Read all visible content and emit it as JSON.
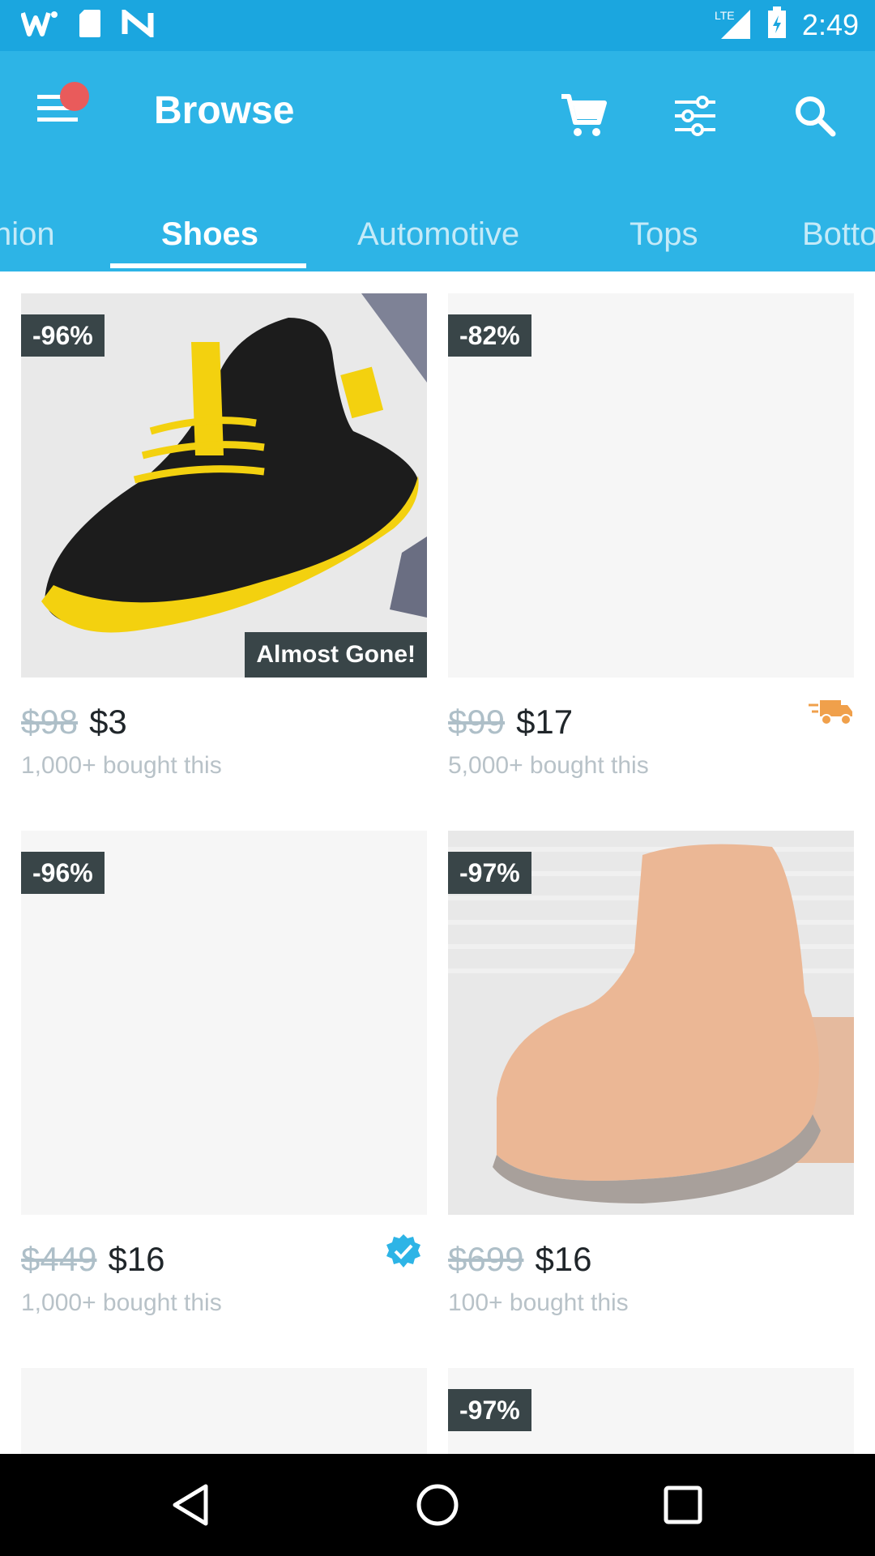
{
  "status": {
    "time": "2:49",
    "network": "LTE"
  },
  "header": {
    "title": "Browse"
  },
  "tabs": [
    {
      "label": "hion"
    },
    {
      "label": "Shoes"
    },
    {
      "label": "Automotive"
    },
    {
      "label": "Tops"
    },
    {
      "label": "Botto"
    }
  ],
  "products": [
    {
      "discount": "-96%",
      "old_price": "$98",
      "price": "$3",
      "bought": "1,000+ bought this",
      "badge": "Almost Gone!"
    },
    {
      "discount": "-82%",
      "old_price": "$99",
      "price": "$17",
      "bought": "5,000+ bought this"
    },
    {
      "discount": "-96%",
      "old_price": "$449",
      "price": "$16",
      "bought": "1,000+ bought this"
    },
    {
      "discount": "-97%",
      "old_price": "$699",
      "price": "$16",
      "bought": "100+ bought this"
    },
    {
      "discount": ""
    },
    {
      "discount": "-97%"
    }
  ],
  "colors": {
    "status_bar": "#1ba6df",
    "app_bar": "#2db4e6",
    "badge_bg": "#394548",
    "notification_dot": "#e95b5b",
    "truck": "#f0a04b"
  }
}
